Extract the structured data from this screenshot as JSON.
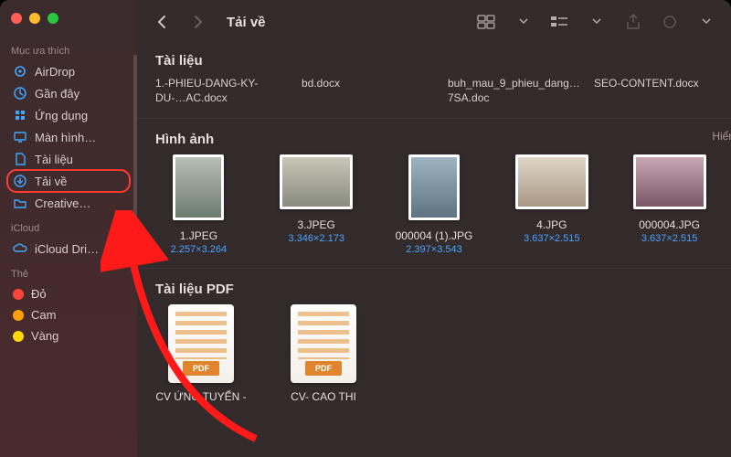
{
  "window": {
    "title": "Tải về"
  },
  "sidebar": {
    "favorites_header": "Mục ưa thích",
    "items": [
      {
        "label": "AirDrop"
      },
      {
        "label": "Gần đây"
      },
      {
        "label": "Ứng dụng"
      },
      {
        "label": "Màn hình…"
      },
      {
        "label": "Tài liệu"
      },
      {
        "label": "Tải về"
      },
      {
        "label": "Creative…"
      }
    ],
    "icloud_header": "iCloud",
    "icloud_items": [
      {
        "label": "iCloud Dri…"
      }
    ],
    "tags_header": "Thẻ",
    "tags": [
      {
        "label": "Đỏ",
        "color": "#ff453a"
      },
      {
        "label": "Cam",
        "color": "#ff9f0a"
      },
      {
        "label": "Vàng",
        "color": "#ffd60a"
      }
    ]
  },
  "sections": {
    "documents": {
      "title": "Tài liệu",
      "files": [
        "1.-PHIEU-DANG-KY-DU-…AC.docx",
        "bd.docx",
        "buh_mau_9_phieu_dang…7SA.doc",
        "SEO-CONTENT.docx"
      ]
    },
    "images": {
      "title": "Hình ảnh",
      "show_all": "Hiển",
      "files": [
        {
          "name": "1.JPEG",
          "dims": "2.257×3.264"
        },
        {
          "name": "3.JPEG",
          "dims": "3.346×2.173"
        },
        {
          "name": "000004 (1).JPG",
          "dims": "2.397×3.543"
        },
        {
          "name": "4.JPG",
          "dims": "3.637×2.515"
        },
        {
          "name": "000004.JPG",
          "dims": "3.637×2.515"
        }
      ]
    },
    "pdfs": {
      "title": "Tài liệu PDF",
      "badge": "PDF",
      "files": [
        "CV ỨNG TUYỂN -",
        "CV- CAO THI"
      ]
    }
  }
}
